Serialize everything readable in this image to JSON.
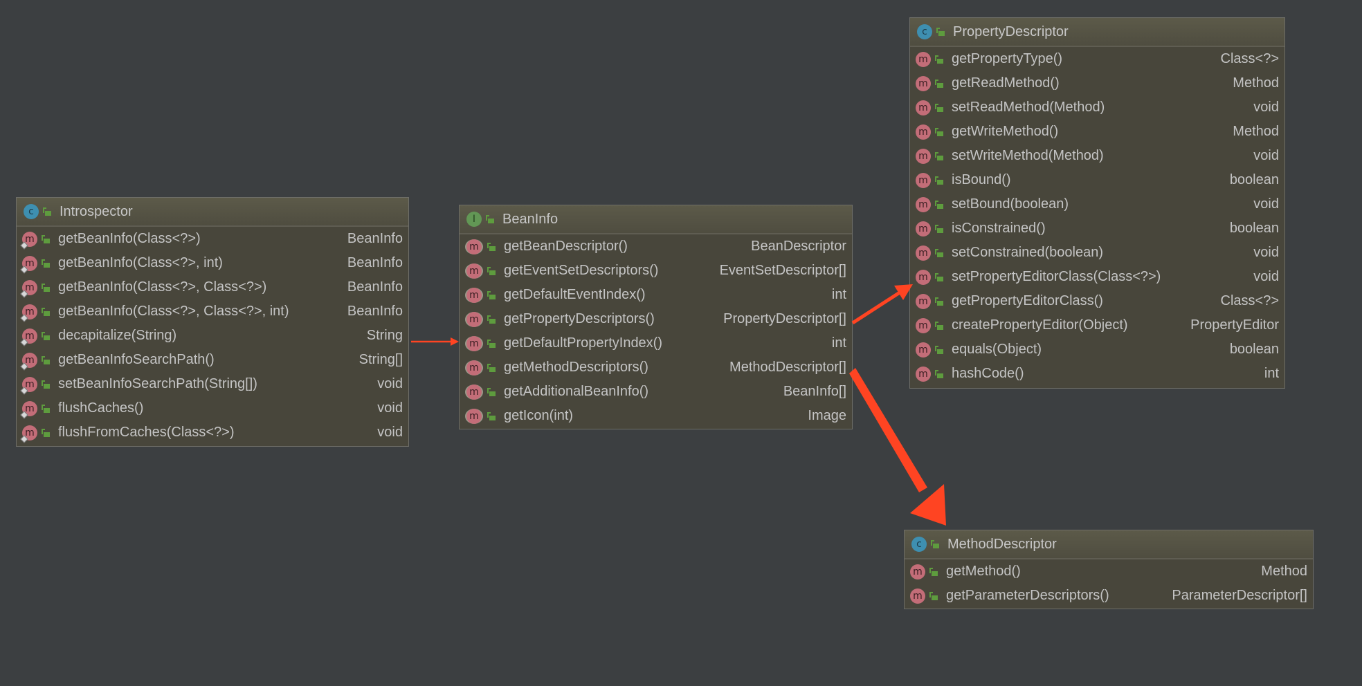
{
  "colors": {
    "background": "#3c3f41",
    "box": "#48463b",
    "arrow": "#ff4422",
    "class_icon": "#3e8fb0",
    "interface_icon": "#629755",
    "method_icon": "#c36d78"
  },
  "boxes": [
    {
      "id": "introspector",
      "kind": "class",
      "icon_label": "c",
      "title": "Introspector",
      "method_style": "static",
      "methods": [
        {
          "name": "getBeanInfo(Class<?>)",
          "type": "BeanInfo"
        },
        {
          "name": "getBeanInfo(Class<?>, int)",
          "type": "BeanInfo"
        },
        {
          "name": "getBeanInfo(Class<?>, Class<?>)",
          "type": "BeanInfo"
        },
        {
          "name": "getBeanInfo(Class<?>, Class<?>, int)",
          "type": "BeanInfo"
        },
        {
          "name": "decapitalize(String)",
          "type": "String"
        },
        {
          "name": "getBeanInfoSearchPath()",
          "type": "String[]"
        },
        {
          "name": "setBeanInfoSearchPath(String[])",
          "type": "void"
        },
        {
          "name": "flushCaches()",
          "type": "void"
        },
        {
          "name": "flushFromCaches(Class<?>)",
          "type": "void"
        }
      ]
    },
    {
      "id": "beaninfo",
      "kind": "interface",
      "icon_label": "I",
      "title": "BeanInfo",
      "method_style": "abstract",
      "methods": [
        {
          "name": "getBeanDescriptor()",
          "type": "BeanDescriptor"
        },
        {
          "name": "getEventSetDescriptors()",
          "type": "EventSetDescriptor[]"
        },
        {
          "name": "getDefaultEventIndex()",
          "type": "int"
        },
        {
          "name": "getPropertyDescriptors()",
          "type": "PropertyDescriptor[]"
        },
        {
          "name": "getDefaultPropertyIndex()",
          "type": "int"
        },
        {
          "name": "getMethodDescriptors()",
          "type": "MethodDescriptor[]"
        },
        {
          "name": "getAdditionalBeanInfo()",
          "type": "BeanInfo[]"
        },
        {
          "name": "getIcon(int)",
          "type": "Image"
        }
      ]
    },
    {
      "id": "propertydescriptor",
      "kind": "class",
      "icon_label": "c",
      "title": "PropertyDescriptor",
      "method_style": "normal",
      "methods": [
        {
          "name": "getPropertyType()",
          "type": "Class<?>"
        },
        {
          "name": "getReadMethod()",
          "type": "Method"
        },
        {
          "name": "setReadMethod(Method)",
          "type": "void"
        },
        {
          "name": "getWriteMethod()",
          "type": "Method"
        },
        {
          "name": "setWriteMethod(Method)",
          "type": "void"
        },
        {
          "name": "isBound()",
          "type": "boolean"
        },
        {
          "name": "setBound(boolean)",
          "type": "void"
        },
        {
          "name": "isConstrained()",
          "type": "boolean"
        },
        {
          "name": "setConstrained(boolean)",
          "type": "void"
        },
        {
          "name": "setPropertyEditorClass(Class<?>)",
          "type": "void"
        },
        {
          "name": "getPropertyEditorClass()",
          "type": "Class<?>"
        },
        {
          "name": "createPropertyEditor(Object)",
          "type": "PropertyEditor"
        },
        {
          "name": "equals(Object)",
          "type": "boolean"
        },
        {
          "name": "hashCode()",
          "type": "int"
        }
      ]
    },
    {
      "id": "methoddescriptor",
      "kind": "class",
      "icon_label": "c",
      "title": "MethodDescriptor",
      "method_style": "normal",
      "methods": [
        {
          "name": "getMethod()",
          "type": "Method"
        },
        {
          "name": "getParameterDescriptors()",
          "type": "ParameterDescriptor[]"
        }
      ]
    }
  ],
  "arrows": [
    {
      "from": "introspector",
      "to": "beaninfo"
    },
    {
      "from": "beaninfo.getPropertyDescriptors()",
      "to": "propertydescriptor"
    },
    {
      "from": "beaninfo.getMethodDescriptors()",
      "to": "methoddescriptor"
    }
  ]
}
